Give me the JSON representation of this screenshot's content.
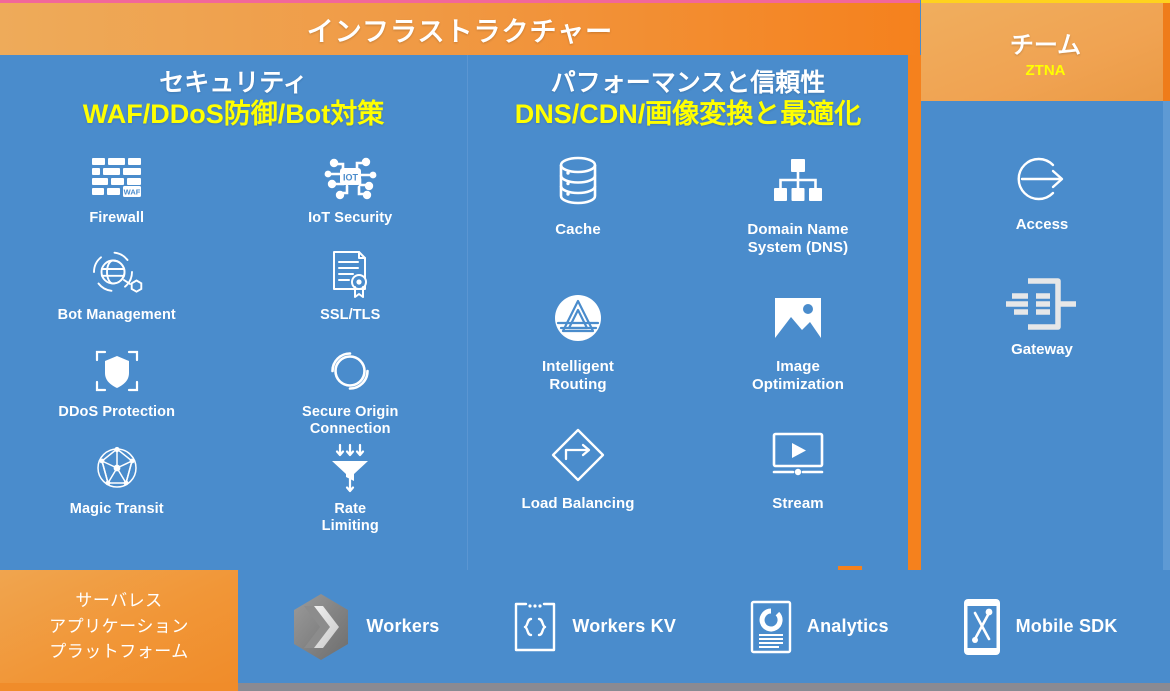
{
  "infrastructure": {
    "header_title": "インフラストラクチャー",
    "columns": [
      {
        "title": "セキュリティ",
        "subtitle": "WAF/DDoS防御/Bot対策",
        "items": [
          {
            "label": "Firewall",
            "icon": "firewall-brickwall-icon"
          },
          {
            "label": "IoT Security",
            "icon": "iot-security-icon"
          },
          {
            "label": "Bot Management",
            "icon": "bot-management-icon"
          },
          {
            "label": "SSL/TLS",
            "icon": "ssl-certificate-icon"
          },
          {
            "label": "DDoS Protection",
            "icon": "shield-scan-icon"
          },
          {
            "label": "Secure Origin\nConnection",
            "icon": "secure-origin-ring-icon"
          },
          {
            "label": "Magic Transit",
            "icon": "magic-transit-network-icon"
          },
          {
            "label": "Rate\nLimiting",
            "icon": "rate-limiting-funnel-icon"
          }
        ]
      },
      {
        "title": "パフォーマンスと信頼性",
        "subtitle": "DNS/CDN/画像変換と最適化",
        "items": [
          {
            "label": "Cache",
            "icon": "cache-database-icon"
          },
          {
            "label": "Domain Name\nSystem (DNS)",
            "icon": "dns-hierarchy-icon"
          },
          {
            "label": "Intelligent\nRouting",
            "icon": "intelligent-routing-icon"
          },
          {
            "label": "Image\nOptimization",
            "icon": "image-optimization-icon"
          },
          {
            "label": "Load Balancing",
            "icon": "load-balancing-diamond-icon"
          },
          {
            "label": "Stream",
            "icon": "stream-video-icon"
          }
        ]
      }
    ]
  },
  "team": {
    "header_title": "チーム",
    "header_subtitle": "ZTNA",
    "items": [
      {
        "label": "Access",
        "icon": "access-arrow-circle-icon"
      },
      {
        "label": "Gateway",
        "icon": "gateway-icon"
      }
    ]
  },
  "serverless": {
    "label_lines": [
      "サーバレス",
      "アプリケーション",
      "プラットフォーム"
    ],
    "items": [
      {
        "label": "Workers",
        "icon": "workers-logo-icon"
      },
      {
        "label": "Workers KV",
        "icon": "workers-kv-braces-icon"
      },
      {
        "label": "Analytics",
        "icon": "analytics-donut-icon"
      },
      {
        "label": "Mobile SDK",
        "icon": "mobile-sdk-icon"
      }
    ]
  },
  "colors": {
    "orange_light": "#eeab5a",
    "orange_dark": "#f5811d",
    "panel_blue": "#4a8ccc",
    "accent_yellow": "#ffff00",
    "white": "#ffffff",
    "bottom_gray": "#8a8a92",
    "top_pink_rule": "#f2679a"
  }
}
